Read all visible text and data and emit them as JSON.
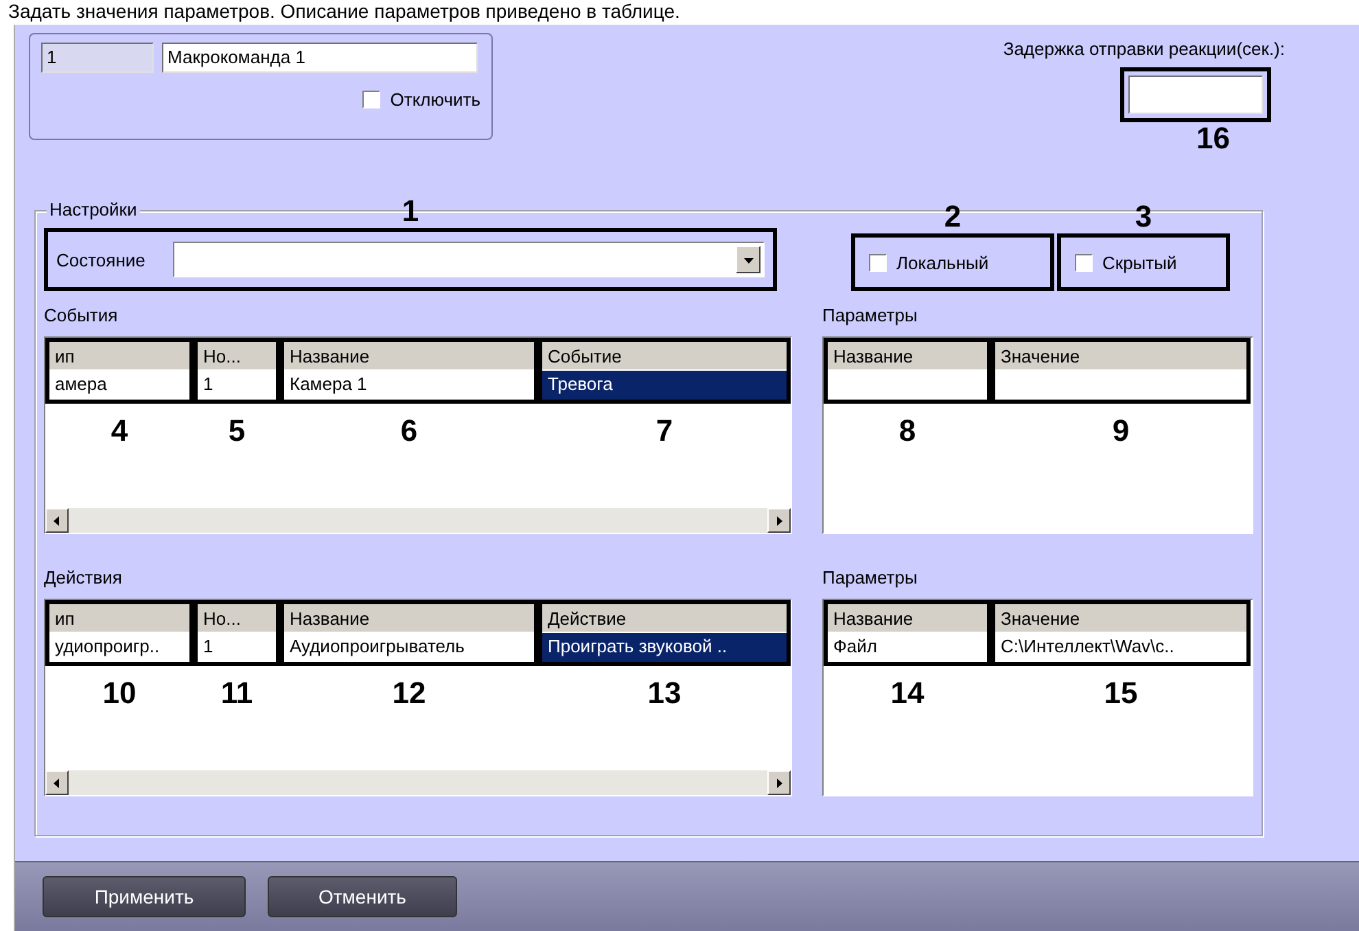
{
  "intro_text": "Задать значения параметров. Описание параметров приведено в таблице.",
  "macro": {
    "number": "1",
    "name": "Макрокоманда 1",
    "disable": {
      "label": "Отключить",
      "checked": false
    }
  },
  "delay": {
    "label": "Задержка отправки реакции(сек.):",
    "callout": "16"
  },
  "settings": {
    "title": "Настройки",
    "state": {
      "label": "Состояние",
      "callout": "1"
    },
    "options": [
      {
        "label": "Локальный",
        "checked": false,
        "callout": "2"
      },
      {
        "label": "Скрытый",
        "checked": false,
        "callout": "3"
      }
    ]
  },
  "events": {
    "title": "События",
    "columns": [
      "ип",
      "Но...",
      "Название",
      "Событие"
    ],
    "rows": [
      {
        "cells": [
          {
            "text": "амера",
            "selected": false
          },
          {
            "text": "1",
            "selected": false
          },
          {
            "text": "Камера 1",
            "selected": false
          },
          {
            "text": "Тревога",
            "selected": true
          }
        ]
      }
    ],
    "callouts": [
      "4",
      "5",
      "6",
      "7"
    ]
  },
  "event_params": {
    "title": "Параметры",
    "columns": [
      "Название",
      "Значение"
    ],
    "callouts": [
      "8",
      "9"
    ]
  },
  "actions": {
    "title": "Действия",
    "columns": [
      "ип",
      "Но...",
      "Название",
      "Действие"
    ],
    "rows": [
      {
        "cells": [
          {
            "text": "удиопроигр..",
            "selected": false
          },
          {
            "text": "1",
            "selected": false
          },
          {
            "text": "Аудиопроигрыватель",
            "selected": false
          },
          {
            "text": "Проиграть звуковой ..",
            "selected": true
          }
        ]
      }
    ],
    "callouts": [
      "10",
      "11",
      "12",
      "13"
    ]
  },
  "action_params": {
    "title": "Параметры",
    "columns": [
      "Название",
      "Значение"
    ],
    "rows": [
      {
        "cells": [
          {
            "text": "Файл",
            "selected": false
          },
          {
            "text": "C:\\Интеллект\\Wav\\c..",
            "selected": false
          }
        ]
      }
    ],
    "callouts": [
      "14",
      "15"
    ]
  },
  "buttons": [
    {
      "label": "Применить"
    },
    {
      "label": "Отменить"
    }
  ]
}
